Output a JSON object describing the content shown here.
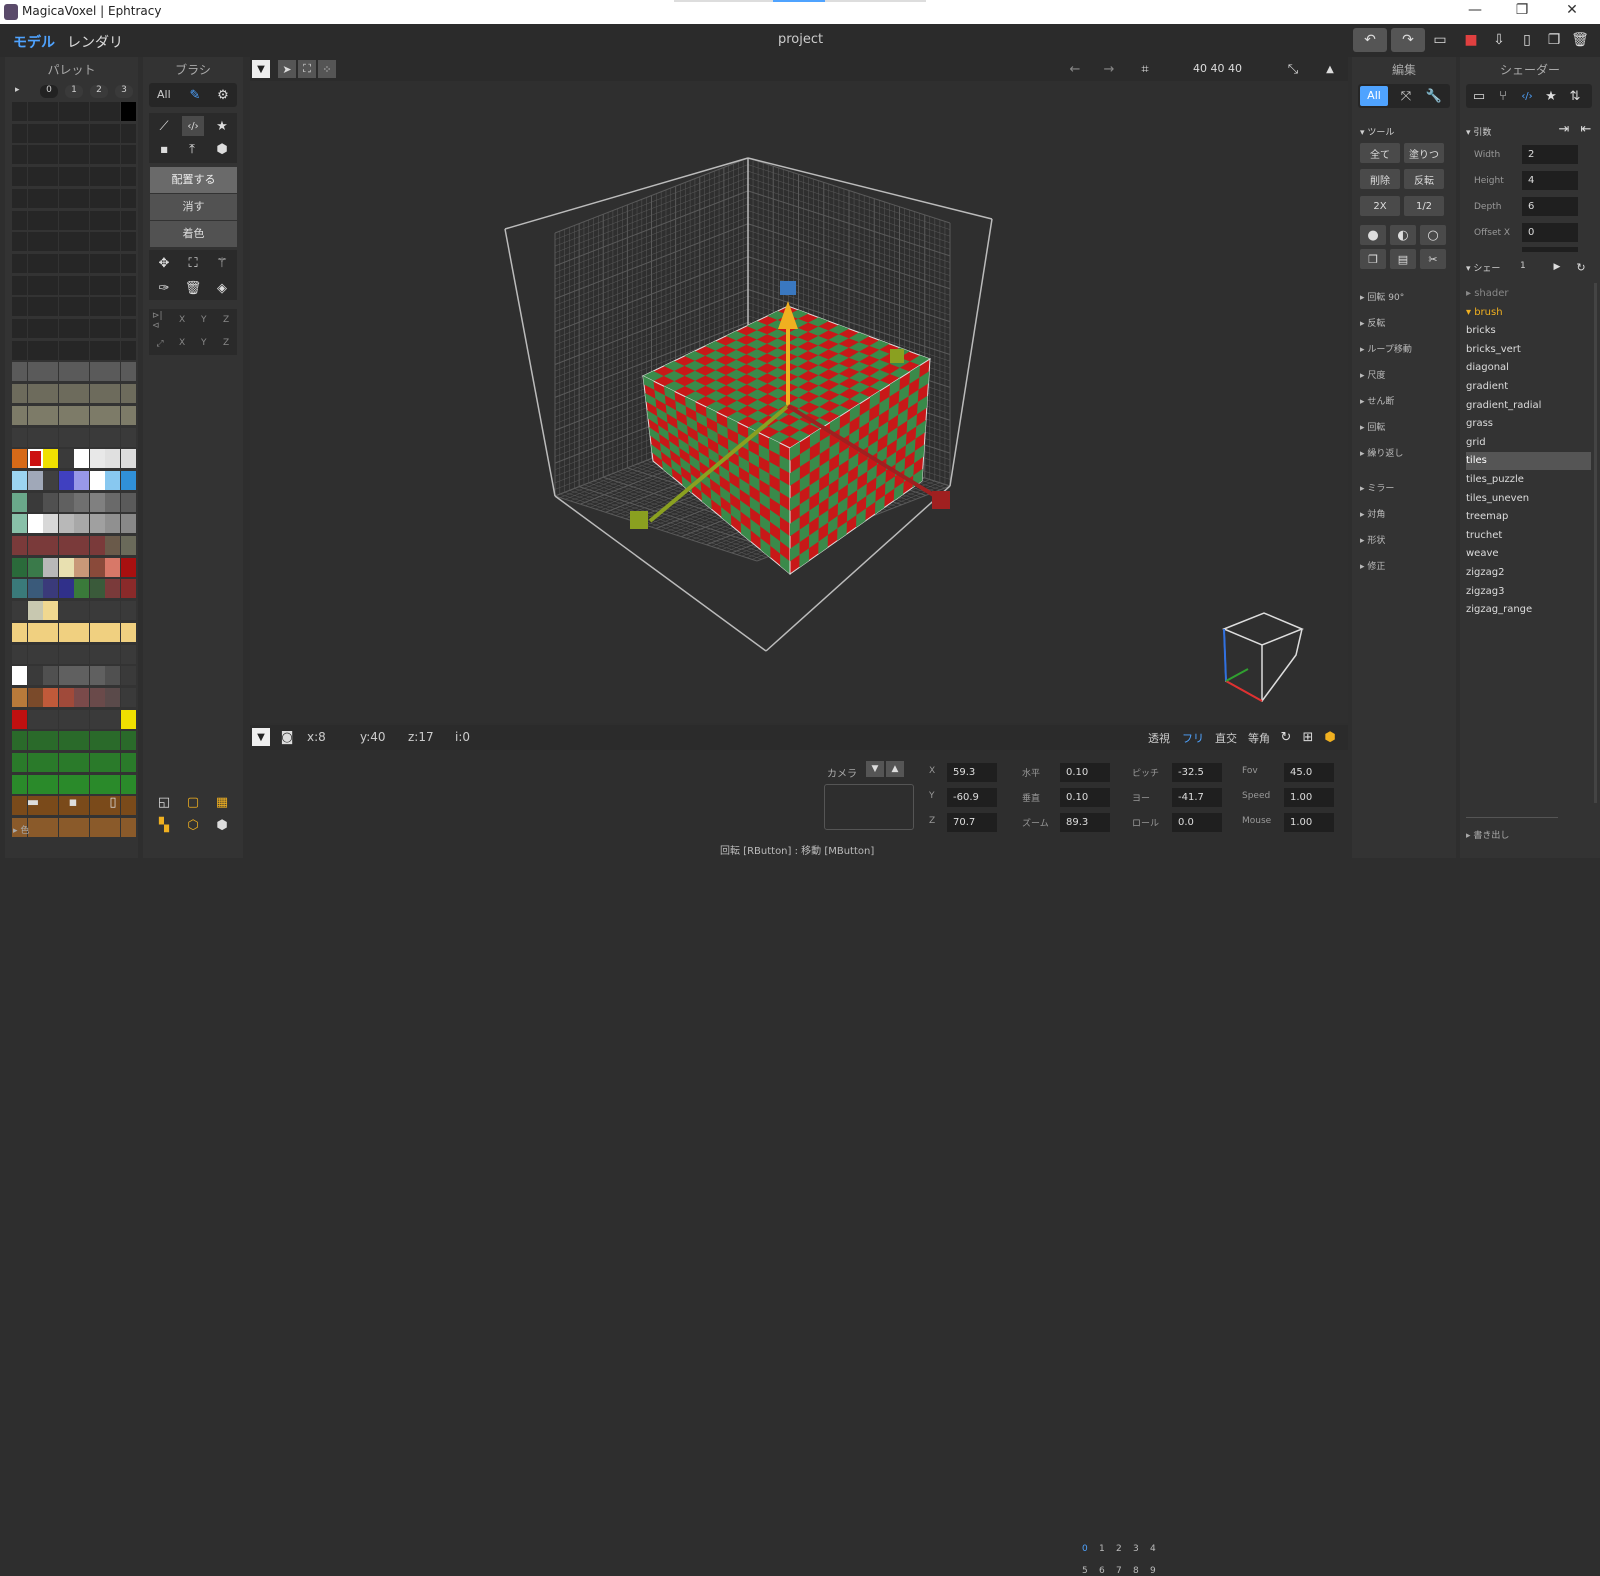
{
  "window": {
    "title": "MagicaVoxel | Ephtracy",
    "min": "—",
    "restore": "❐",
    "close": "✕"
  },
  "menu": {
    "model": "モデル",
    "render": "レンダリ",
    "project": "project"
  },
  "palette": {
    "title": "パレット",
    "tabs": [
      "▸",
      "0",
      "1",
      "2",
      "3"
    ],
    "color_label": "▸ 色"
  },
  "brush": {
    "title": "ブラシ",
    "all": "All",
    "attach": "配置する",
    "erase": "消す",
    "paint": "着色",
    "axes1": [
      "X",
      "Y",
      "Z"
    ],
    "axes2": [
      "X",
      "Y",
      "Z"
    ]
  },
  "viewport": {
    "size": "40 40 40",
    "coords": {
      "x": "x:8",
      "y": "y:40",
      "z": "z:17",
      "i": "i:0"
    },
    "hint": "回転 [RButton] : 移動 [MButton]",
    "view_modes": {
      "persp": "透視",
      "free": "フリ",
      "ortho": "直交",
      "iso": "等角"
    }
  },
  "camera": {
    "label": "カメラ",
    "slots": [
      "0",
      "1",
      "2",
      "3",
      "4",
      "5",
      "6",
      "7",
      "8",
      "9"
    ],
    "x": {
      "label": "X",
      "value": "59.3"
    },
    "y": {
      "label": "Y",
      "value": "-60.9"
    },
    "z": {
      "label": "Z",
      "value": "70.7"
    },
    "horizontal": {
      "label": "水平",
      "value": "0.10"
    },
    "vertical": {
      "label": "垂直",
      "value": "0.10"
    },
    "zoom": {
      "label": "ズーム",
      "value": "89.3"
    },
    "pitch": {
      "label": "ピッチ",
      "value": "-32.5"
    },
    "yaw": {
      "label": "ヨー",
      "value": "-41.7"
    },
    "roll": {
      "label": "ロール",
      "value": "0.0"
    },
    "fov": {
      "label": "Fov",
      "value": "45.0"
    },
    "speed": {
      "label": "Speed",
      "value": "1.00"
    },
    "mouse": {
      "label": "Mouse",
      "value": "1.00"
    }
  },
  "edit": {
    "title": "編集",
    "all": "All",
    "tools_header": "▾ ツール",
    "all_btn": "全て",
    "fill": "塗りつ",
    "delete": "削除",
    "invert": "反転",
    "x2": "2X",
    "half": "1/2",
    "sections": [
      "▸ 回転 90°",
      "▸ 反転",
      "▸ ループ移動",
      "▸ 尺度",
      "▸ せん断",
      "▸ 回転",
      "▸ 繰り返し",
      "▸ ミラー",
      "▸ 対角",
      "▸ 形状",
      "▸ 修正"
    ]
  },
  "shader": {
    "title": "シェーダー",
    "args_header": "▾ 引数",
    "args": [
      {
        "label": "Width",
        "value": "2"
      },
      {
        "label": "Height",
        "value": "4"
      },
      {
        "label": "Depth",
        "value": "6"
      },
      {
        "label": "Offset X",
        "value": "0"
      }
    ],
    "shader_header": "▾ シェー",
    "shader_count": "1",
    "items": [
      "shader",
      "brush",
      "bricks",
      "bricks_vert",
      "diagonal",
      "gradient",
      "gradient_radial",
      "grass",
      "grid",
      "tiles",
      "tiles_puzzle",
      "tiles_uneven",
      "treemap",
      "truchet",
      "weave",
      "zigzag2",
      "zigzag3",
      "zigzag_range"
    ],
    "selected": "tiles",
    "export": "▸ 書き出し"
  },
  "colors": {
    "accent": "#4fa3ff",
    "save_red": "#e04040",
    "cube_red": "#e02020",
    "cube_green": "#3a8a4a"
  }
}
